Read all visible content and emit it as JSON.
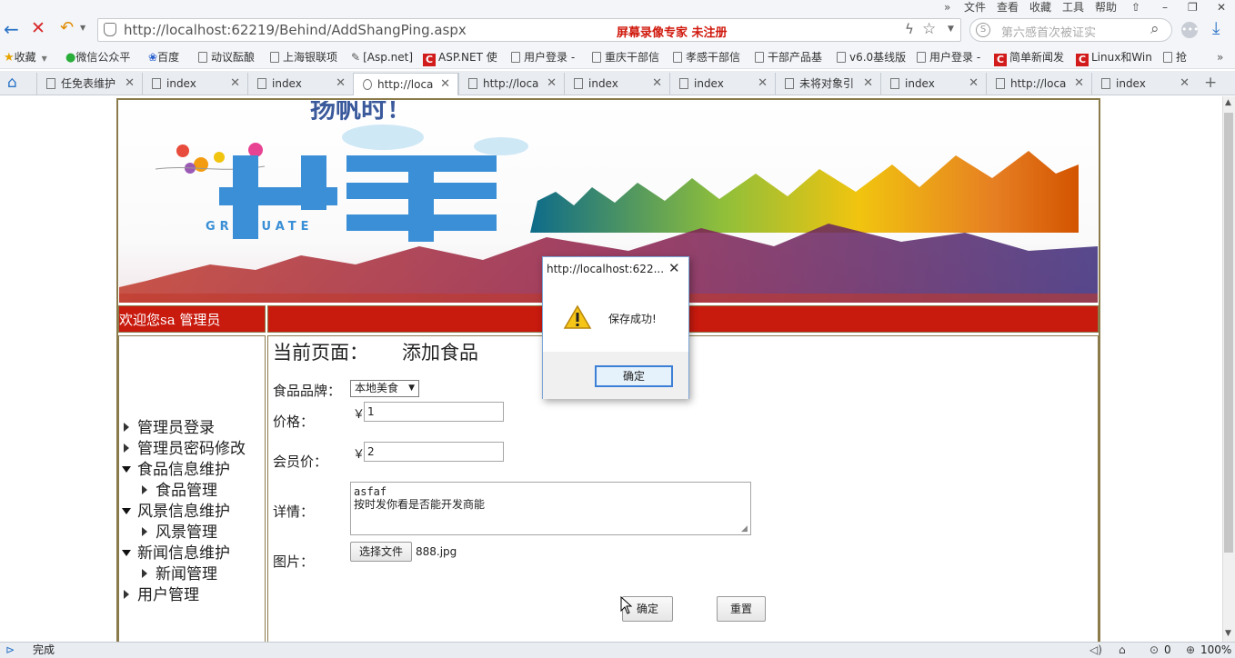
{
  "browser": {
    "menu": [
      "文件",
      "查看",
      "收藏",
      "工具",
      "帮助"
    ],
    "url": "http://localhost:62219/Behind/AddShangPing.aspx",
    "watermark": "屏幕录像专家  未注册",
    "search_placeholder": "第六感首次被证实",
    "favorites": [
      {
        "label": "收藏",
        "kind": "star"
      },
      {
        "label": "微信公众平",
        "kind": "wechat"
      },
      {
        "label": "百度",
        "kind": "paw"
      },
      {
        "label": "动议酝酿",
        "kind": "page"
      },
      {
        "label": "上海银联项",
        "kind": "page"
      },
      {
        "label": "[Asp.net]",
        "kind": "pen"
      },
      {
        "label": "ASP.NET 使",
        "kind": "red"
      },
      {
        "label": "用户登录 -",
        "kind": "page"
      },
      {
        "label": "重庆干部信",
        "kind": "page"
      },
      {
        "label": "孝感干部信",
        "kind": "page"
      },
      {
        "label": "干部产品基",
        "kind": "page"
      },
      {
        "label": "v6.0基线版",
        "kind": "page"
      },
      {
        "label": "用户登录 -",
        "kind": "page"
      },
      {
        "label": "简单新闻发",
        "kind": "red"
      },
      {
        "label": "Linux和Win",
        "kind": "red"
      },
      {
        "label": "抢",
        "kind": "page"
      }
    ],
    "tabs": [
      {
        "label": "任免表维护",
        "active": false
      },
      {
        "label": "index",
        "active": false
      },
      {
        "label": "index",
        "active": false
      },
      {
        "label": "http://loca",
        "active": true
      },
      {
        "label": "http://loca",
        "active": false
      },
      {
        "label": "index",
        "active": false
      },
      {
        "label": "index",
        "active": false
      },
      {
        "label": "未将对象引",
        "active": false
      },
      {
        "label": "index",
        "active": false
      },
      {
        "label": "http://loca",
        "active": false
      },
      {
        "label": "index",
        "active": false
      }
    ],
    "status": "完成",
    "status_count": "0",
    "zoom": "100%"
  },
  "page": {
    "welcome": "欢迎您sa  管理员",
    "nav": [
      {
        "label": "管理员登录",
        "level": 0,
        "expanded": false
      },
      {
        "label": "管理员密码修改",
        "level": 0,
        "expanded": false
      },
      {
        "label": "食品信息维护",
        "level": 0,
        "expanded": true
      },
      {
        "label": "食品管理",
        "level": 1,
        "expanded": false
      },
      {
        "label": "风景信息维护",
        "level": 0,
        "expanded": true
      },
      {
        "label": "风景管理",
        "level": 1,
        "expanded": false
      },
      {
        "label": "新闻信息维护",
        "level": 0,
        "expanded": true
      },
      {
        "label": "新闻管理",
        "level": 1,
        "expanded": false
      },
      {
        "label": "用户管理",
        "level": 0,
        "expanded": false
      }
    ],
    "current_page_label": "当前页面：",
    "current_page_value": "添加食品",
    "form": {
      "brand_label": "食品品牌：",
      "brand_value": "本地美食",
      "price_label": "价格：",
      "price_currency": "￥",
      "price_value": "1",
      "member_price_label": "会员价：",
      "member_price_currency": "￥",
      "member_price_value": "2",
      "detail_label": "详情：",
      "detail_value": "asfaf\n按时发你看是否能开发商能",
      "image_label": "图片：",
      "choose_file_label": "选择文件",
      "file_name": "888.jpg",
      "submit_label": "确定",
      "reset_label": "重置"
    },
    "banner_text": "GRADUATE"
  },
  "dialog": {
    "title": "http://localhost:622...",
    "message": "保存成功!",
    "ok_label": "确定"
  },
  "colors": {
    "accent_red": "#c91a0e",
    "frame_border": "#8b7a4a",
    "banner_blue": "#3a8fd6"
  }
}
